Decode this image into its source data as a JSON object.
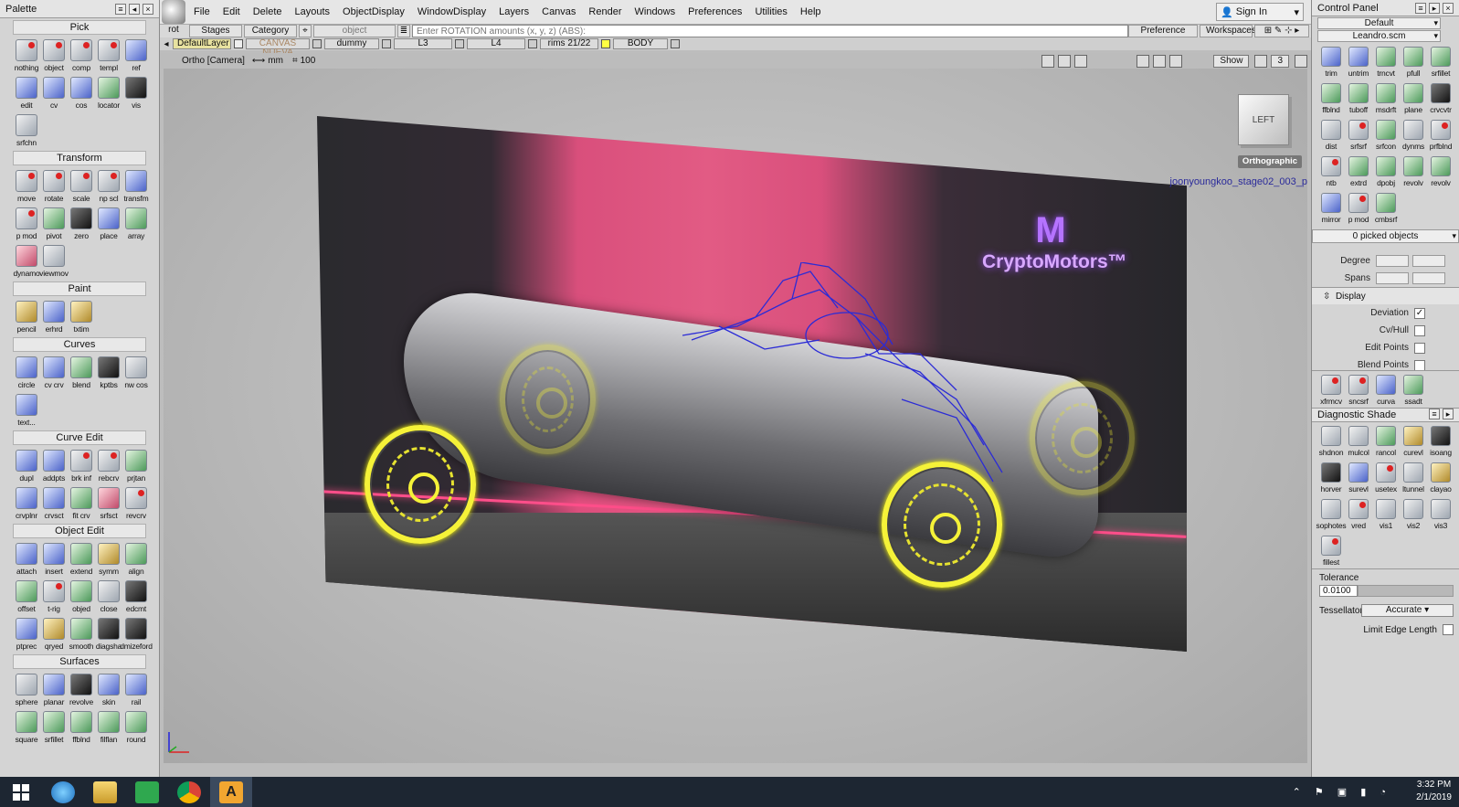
{
  "palette": {
    "title": "Palette",
    "sections": [
      {
        "title": "Pick",
        "tools": [
          {
            "label": "nothing",
            "color": "red"
          },
          {
            "label": "object",
            "color": "red"
          },
          {
            "label": "comp",
            "color": "red"
          },
          {
            "label": "templ",
            "color": "red"
          },
          {
            "label": "ref",
            "color": "blue"
          },
          {
            "label": "edit",
            "color": "blue"
          },
          {
            "label": "cv",
            "color": "blue"
          },
          {
            "label": "cos",
            "color": "blue"
          },
          {
            "label": "locator",
            "color": "green"
          },
          {
            "label": "vis",
            "color": "dark"
          },
          {
            "label": "srfchn",
            "color": ""
          }
        ]
      },
      {
        "title": "Transform",
        "tools": [
          {
            "label": "move",
            "color": "red"
          },
          {
            "label": "rotate",
            "color": "red"
          },
          {
            "label": "scale",
            "color": "red"
          },
          {
            "label": "np scl",
            "color": "red"
          },
          {
            "label": "transfm",
            "color": "blue"
          },
          {
            "label": "p mod",
            "color": "red"
          },
          {
            "label": "pivot",
            "color": "green"
          },
          {
            "label": "zero",
            "color": "dark"
          },
          {
            "label": "place",
            "color": "blue"
          },
          {
            "label": "array",
            "color": "green"
          },
          {
            "label": "dynamo",
            "color": "pink"
          },
          {
            "label": "viewmov",
            "color": ""
          }
        ]
      },
      {
        "title": "Paint",
        "tools": [
          {
            "label": "pencil",
            "color": "gold"
          },
          {
            "label": "erhrd",
            "color": "blue"
          },
          {
            "label": "txtim",
            "color": "gold"
          }
        ]
      },
      {
        "title": "Curves",
        "tools": [
          {
            "label": "circle",
            "color": "blue"
          },
          {
            "label": "cv crv",
            "color": "blue"
          },
          {
            "label": "blend",
            "color": "green"
          },
          {
            "label": "kptbs",
            "color": "dark"
          },
          {
            "label": "nw cos",
            "color": ""
          },
          {
            "label": "text...",
            "color": "blue"
          }
        ]
      },
      {
        "title": "Curve Edit",
        "tools": [
          {
            "label": "dupl",
            "color": "blue"
          },
          {
            "label": "addpts",
            "color": "blue"
          },
          {
            "label": "brk inf",
            "color": "red"
          },
          {
            "label": "rebcrv",
            "color": "red"
          },
          {
            "label": "prjtan",
            "color": "green"
          },
          {
            "label": "crvplnr",
            "color": "blue"
          },
          {
            "label": "crvsct",
            "color": "blue"
          },
          {
            "label": "fit crv",
            "color": "green"
          },
          {
            "label": "srfsct",
            "color": "pink"
          },
          {
            "label": "revcrv",
            "color": "red"
          }
        ]
      },
      {
        "title": "Object Edit",
        "tools": [
          {
            "label": "attach",
            "color": "blue"
          },
          {
            "label": "insert",
            "color": "blue"
          },
          {
            "label": "extend",
            "color": "green"
          },
          {
            "label": "symm",
            "color": "gold"
          },
          {
            "label": "align",
            "color": "green"
          },
          {
            "label": "offset",
            "color": "green"
          },
          {
            "label": "t-rig",
            "color": "red"
          },
          {
            "label": "objed",
            "color": "green"
          },
          {
            "label": "close",
            "color": ""
          },
          {
            "label": "edcmt",
            "color": "dark"
          },
          {
            "label": "ptprec",
            "color": "blue"
          },
          {
            "label": "qryed",
            "color": "gold"
          },
          {
            "label": "smooth",
            "color": "green"
          },
          {
            "label": "diagsha",
            "color": "dark"
          },
          {
            "label": "dmizeford",
            "color": "dark"
          }
        ]
      },
      {
        "title": "Surfaces",
        "tools": [
          {
            "label": "sphere",
            "color": ""
          },
          {
            "label": "planar",
            "color": "blue"
          },
          {
            "label": "revolve",
            "color": "dark"
          },
          {
            "label": "skin",
            "color": "blue"
          },
          {
            "label": "rail",
            "color": "blue"
          },
          {
            "label": "square",
            "color": "green"
          },
          {
            "label": "srfillet",
            "color": "green"
          },
          {
            "label": "ffblnd",
            "color": "green"
          },
          {
            "label": "filflan",
            "color": "green"
          },
          {
            "label": "round",
            "color": "green"
          }
        ]
      }
    ]
  },
  "menubar": {
    "app_label": "rot",
    "items": [
      "File",
      "Edit",
      "Delete",
      "Layouts",
      "ObjectDisplay",
      "WindowDisplay",
      "Layers",
      "Canvas",
      "Render",
      "Windows",
      "Preferences",
      "Utilities",
      "Help"
    ],
    "signin": "Sign In"
  },
  "bar2": {
    "stages": "Stages",
    "category": "Category",
    "object": "object",
    "command_placeholder": "Enter ROTATION amounts (x, y, z) (ABS):",
    "preference_sets": "Preference Sets",
    "workspaces": "Workspaces"
  },
  "layers": [
    "DefaultLayer",
    "CANVAS NUEVA",
    "dummy",
    "L3",
    "L4",
    "rims 21/22",
    "BODY"
  ],
  "viewbar": {
    "camera": "Ortho [Camera]",
    "units": "mm",
    "grid": "100",
    "show": "Show",
    "count": "3"
  },
  "viewport": {
    "brand": "CryptoMotors™",
    "object_name": "joonyoungkoo_stage02_003_p",
    "viewcube_face": "LEFT",
    "view_label": "Orthographic"
  },
  "cpanel": {
    "title": "Control Panel",
    "preset": "Default",
    "file": "Leandro.scm",
    "tools_top": [
      {
        "label": "trim",
        "color": "blue"
      },
      {
        "label": "untrim",
        "color": "blue"
      },
      {
        "label": "trncvt",
        "color": "green"
      },
      {
        "label": "pfull",
        "color": "green"
      },
      {
        "label": "srfillet",
        "color": "green"
      },
      {
        "label": "ffblnd",
        "color": "green"
      },
      {
        "label": "tuboff",
        "color": "green"
      },
      {
        "label": "msdrft",
        "color": "green"
      },
      {
        "label": "plane",
        "color": "green"
      },
      {
        "label": "crvcvtr",
        "color": "dark"
      },
      {
        "label": "dist",
        "color": ""
      },
      {
        "label": "srfsrf",
        "color": "red"
      },
      {
        "label": "srfcon",
        "color": "green"
      },
      {
        "label": "dynms",
        "color": ""
      },
      {
        "label": "prfblnd",
        "color": "red"
      },
      {
        "label": "ntb",
        "color": "red"
      },
      {
        "label": "extrd",
        "color": "green"
      },
      {
        "label": "dpobj",
        "color": "green"
      },
      {
        "label": "revolv",
        "color": "green"
      },
      {
        "label": "revolv",
        "color": "green"
      },
      {
        "label": "mirror",
        "color": "blue"
      },
      {
        "label": "p mod",
        "color": "red"
      },
      {
        "label": "cmbsrf",
        "color": "green"
      }
    ],
    "picked": "0 picked objects",
    "degree": "Degree",
    "spans": "Spans",
    "display_title": "Display",
    "display_rows": [
      {
        "label": "Deviation",
        "checked": "✓"
      },
      {
        "label": "Cv/Hull",
        "checked": ""
      },
      {
        "label": "Edit Points",
        "checked": ""
      },
      {
        "label": "Blend Points",
        "checked": ""
      }
    ],
    "tools_mid": [
      {
        "label": "xfrmcv",
        "color": "red"
      },
      {
        "label": "sncsrf",
        "color": "red"
      },
      {
        "label": "curva",
        "color": "blue"
      },
      {
        "label": "ssadt",
        "color": "green"
      }
    ],
    "diag_title": "Diagnostic Shade",
    "diag_tools": [
      {
        "label": "shdnon",
        "color": ""
      },
      {
        "label": "mulcol",
        "color": ""
      },
      {
        "label": "rancol",
        "color": "green"
      },
      {
        "label": "curevl",
        "color": "gold"
      },
      {
        "label": "isoang",
        "color": "dark"
      },
      {
        "label": "horver",
        "color": "dark"
      },
      {
        "label": "surevl",
        "color": "blue"
      },
      {
        "label": "usetex",
        "color": "red"
      },
      {
        "label": "ltunnel",
        "color": ""
      },
      {
        "label": "clayao",
        "color": "gold"
      },
      {
        "label": "sophotes",
        "color": ""
      },
      {
        "label": "vred",
        "color": "red"
      },
      {
        "label": "vis1",
        "color": ""
      },
      {
        "label": "vis2",
        "color": ""
      },
      {
        "label": "vis3",
        "color": ""
      },
      {
        "label": "fillest",
        "color": "red"
      }
    ],
    "tolerance_label": "Tolerance",
    "tolerance_value": "0.0100",
    "tessellator_label": "Tessellator",
    "tessellator_value": "Accurate",
    "limit_edge": "Limit Edge Length"
  },
  "taskbar": {
    "time": "3:32 PM",
    "date": "2/1/2019",
    "apps": [
      "start-icon",
      "ie-icon",
      "explorer-icon",
      "store-icon",
      "chrome-icon",
      "alias-icon"
    ]
  }
}
